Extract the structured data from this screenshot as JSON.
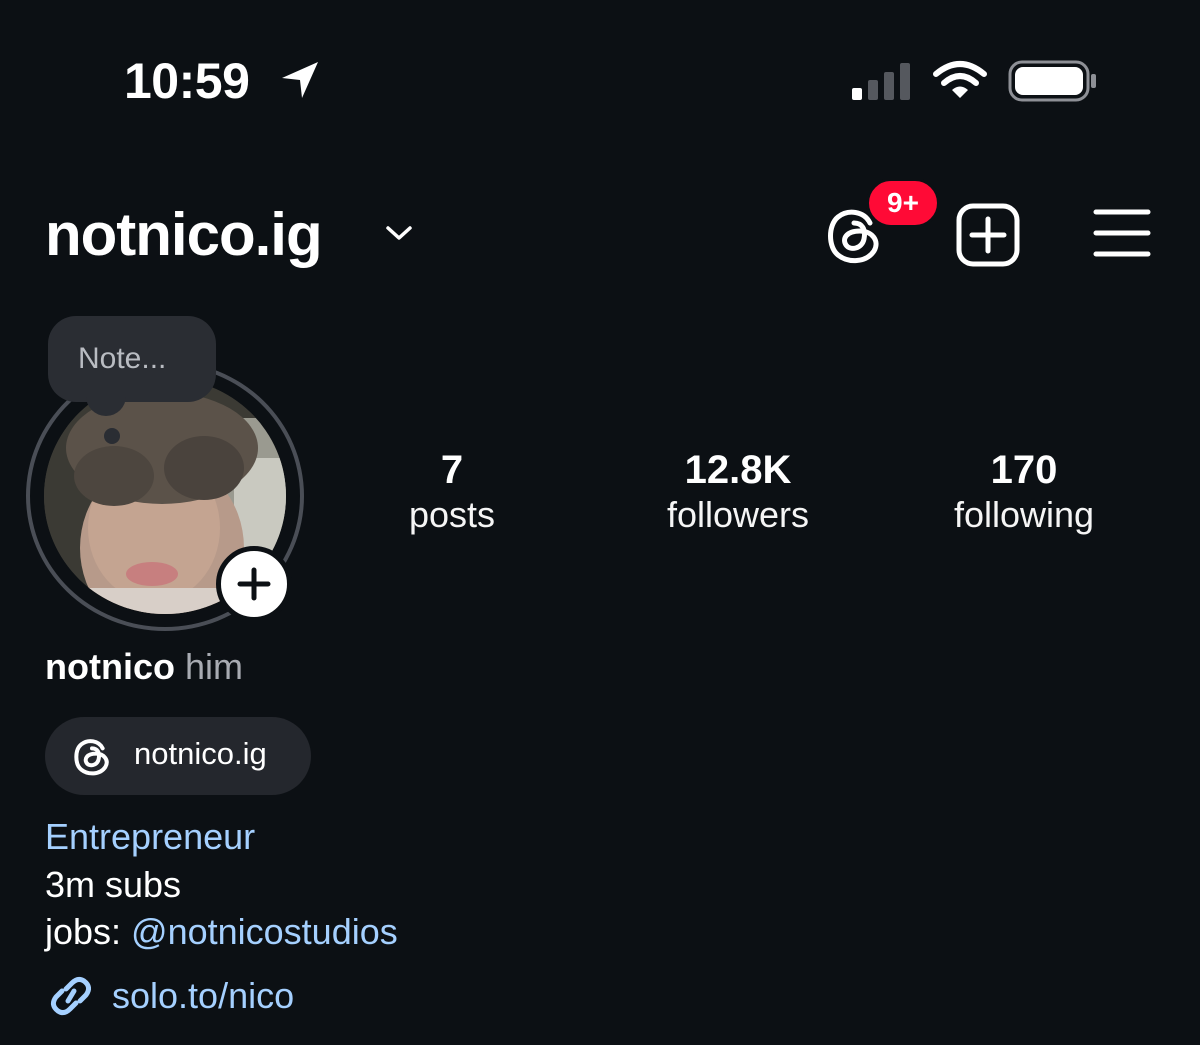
{
  "status_bar": {
    "time": "10:59",
    "icons": [
      "location-arrow-icon",
      "cellular-signal-icon",
      "wifi-icon",
      "battery-icon"
    ]
  },
  "header": {
    "username": "notnico.ig",
    "threads_badge": "9+",
    "icons": [
      "chevron-down-icon",
      "threads-icon",
      "new-post-icon",
      "hamburger-menu-icon"
    ]
  },
  "note": {
    "placeholder": "Note..."
  },
  "stats": [
    {
      "value": "7",
      "label": "posts"
    },
    {
      "value": "12.8K",
      "label": "followers"
    },
    {
      "value": "170",
      "label": "following"
    }
  ],
  "bio": {
    "name": "notnico",
    "pronouns": "him",
    "threads_handle": "notnico.ig",
    "category": "Entrepreneur",
    "line1": "3m subs",
    "jobs_prefix": "jobs: ",
    "jobs_mention": "@notnicostudios",
    "link": "solo.to/nico"
  },
  "colors": {
    "background": "#0c1014",
    "link": "#a5d0ff",
    "badge": "#ff0a36",
    "pill": "#24272d"
  }
}
